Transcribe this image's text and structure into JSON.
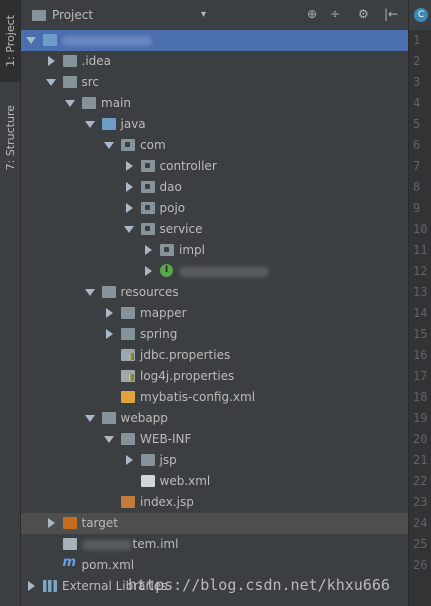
{
  "side_tabs": {
    "project": "1: Project",
    "structure": "7: Structure"
  },
  "header": {
    "title": "Project",
    "dropdown": "▾",
    "buttons": [
      "⊕",
      "÷",
      "⚙",
      "|←"
    ]
  },
  "tree": [
    {
      "label": "",
      "depth": 0,
      "expanded": true,
      "icon": "folder-blue",
      "selected": true,
      "blurred": true
    },
    {
      "label": ".idea",
      "depth": 1,
      "expanded": false,
      "icon": "folder"
    },
    {
      "label": "src",
      "depth": 1,
      "expanded": true,
      "icon": "folder"
    },
    {
      "label": "main",
      "depth": 2,
      "expanded": true,
      "icon": "folder"
    },
    {
      "label": "java",
      "depth": 3,
      "expanded": true,
      "icon": "folder-blue"
    },
    {
      "label": "com",
      "depth": 4,
      "expanded": true,
      "icon": "pkg"
    },
    {
      "label": "controller",
      "depth": 5,
      "expanded": false,
      "icon": "pkg"
    },
    {
      "label": "dao",
      "depth": 5,
      "expanded": false,
      "icon": "pkg"
    },
    {
      "label": "pojo",
      "depth": 5,
      "expanded": false,
      "icon": "pkg"
    },
    {
      "label": "service",
      "depth": 5,
      "expanded": true,
      "icon": "pkg"
    },
    {
      "label": "impl",
      "depth": 6,
      "expanded": false,
      "icon": "pkg"
    },
    {
      "label": "",
      "depth": 6,
      "expanded": false,
      "icon": "interface",
      "blurred": true
    },
    {
      "label": "resources",
      "depth": 3,
      "expanded": true,
      "icon": "folder-res"
    },
    {
      "label": "mapper",
      "depth": 4,
      "expanded": false,
      "icon": "folder"
    },
    {
      "label": "spring",
      "depth": 4,
      "expanded": false,
      "icon": "folder"
    },
    {
      "label": "jdbc.properties",
      "depth": 4,
      "icon": "props"
    },
    {
      "label": "log4j.properties",
      "depth": 4,
      "icon": "props"
    },
    {
      "label": "mybatis-config.xml",
      "depth": 4,
      "icon": "xml"
    },
    {
      "label": "webapp",
      "depth": 3,
      "expanded": true,
      "icon": "folder-web"
    },
    {
      "label": "WEB-INF",
      "depth": 4,
      "expanded": true,
      "icon": "folder"
    },
    {
      "label": "jsp",
      "depth": 5,
      "expanded": false,
      "icon": "folder"
    },
    {
      "label": "web.xml",
      "depth": 5,
      "icon": "webxml"
    },
    {
      "label": "index.jsp",
      "depth": 4,
      "icon": "jsp"
    },
    {
      "label": "target",
      "depth": 1,
      "expanded": false,
      "icon": "folder-orange",
      "highlight": true
    },
    {
      "label": "tem.iml",
      "depth": 1,
      "icon": "iml",
      "blurred": true
    },
    {
      "label": "pom.xml",
      "depth": 1,
      "icon": "maven"
    },
    {
      "label": "External Libraries",
      "depth": 0,
      "expanded": false,
      "icon": "libs"
    }
  ],
  "gutter": {
    "tab_icon": "C",
    "line_numbers": [
      "1",
      "2",
      "3",
      "4",
      "5",
      "6",
      "7",
      "8",
      "9",
      "10",
      "11",
      "12",
      "13",
      "14",
      "15",
      "16",
      "17",
      "18",
      "19",
      "20",
      "21",
      "22",
      "23",
      "24",
      "25",
      "26"
    ]
  },
  "watermark": "https://blog.csdn.net/khxu666",
  "colors": {
    "background": "#3c3f41",
    "selection": "#4b6eaf",
    "highlight": "#4e4e4e",
    "gutter": "#313335"
  }
}
